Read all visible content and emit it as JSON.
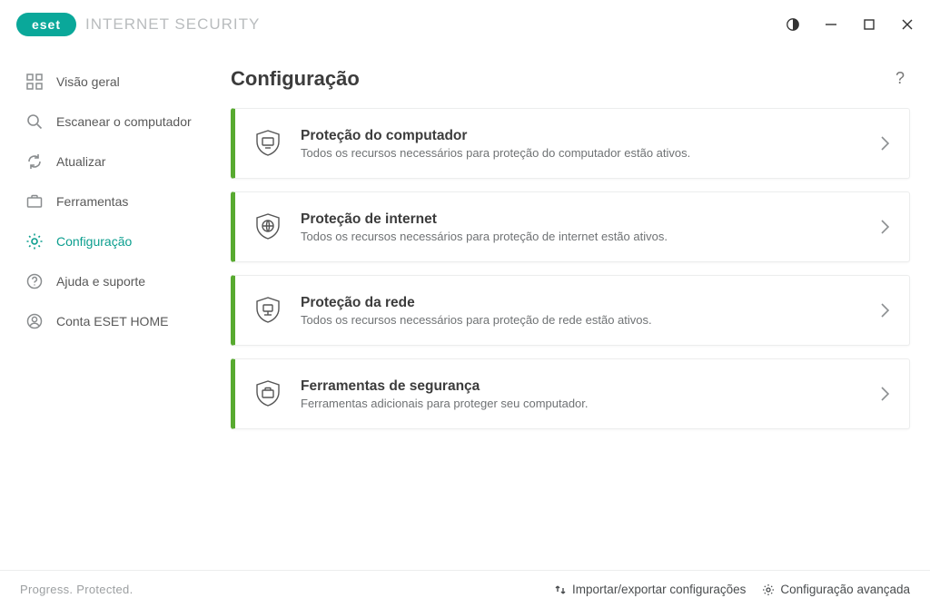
{
  "brand": {
    "logo_text": "eset",
    "product_name": "INTERNET SECURITY"
  },
  "window_controls": {
    "contrast_icon": "contrast-icon",
    "minimize_icon": "minimize-icon",
    "maximize_icon": "maximize-icon",
    "close_icon": "close-icon"
  },
  "sidebar": {
    "items": [
      {
        "icon": "dashboard-icon",
        "label": "Visão geral",
        "active": false
      },
      {
        "icon": "search-icon",
        "label": "Escanear o computador",
        "active": false
      },
      {
        "icon": "refresh-icon",
        "label": "Atualizar",
        "active": false
      },
      {
        "icon": "briefcase-icon",
        "label": "Ferramentas",
        "active": false
      },
      {
        "icon": "gear-icon",
        "label": "Configuração",
        "active": true
      },
      {
        "icon": "help-circle-icon",
        "label": "Ajuda e suporte",
        "active": false
      },
      {
        "icon": "user-circle-icon",
        "label": "Conta ESET HOME",
        "active": false
      }
    ]
  },
  "page": {
    "title": "Configuração",
    "help_label": "?"
  },
  "cards": [
    {
      "icon": "shield-monitor-icon",
      "title": "Proteção do computador",
      "subtitle": "Todos os recursos necessários para proteção do computador estão ativos."
    },
    {
      "icon": "shield-globe-icon",
      "title": "Proteção de internet",
      "subtitle": "Todos os recursos necessários para proteção de internet estão ativos."
    },
    {
      "icon": "shield-network-icon",
      "title": "Proteção da rede",
      "subtitle": "Todos os recursos necessários para proteção de rede estão ativos."
    },
    {
      "icon": "shield-tools-icon",
      "title": "Ferramentas de segurança",
      "subtitle": "Ferramentas adicionais para proteger seu computador."
    }
  ],
  "footer": {
    "tagline": "Progress. Protected.",
    "import_export": "Importar/exportar configurações",
    "advanced": "Configuração avançada"
  },
  "colors": {
    "accent": "#0b9e8e",
    "status_ok": "#58aa30"
  }
}
